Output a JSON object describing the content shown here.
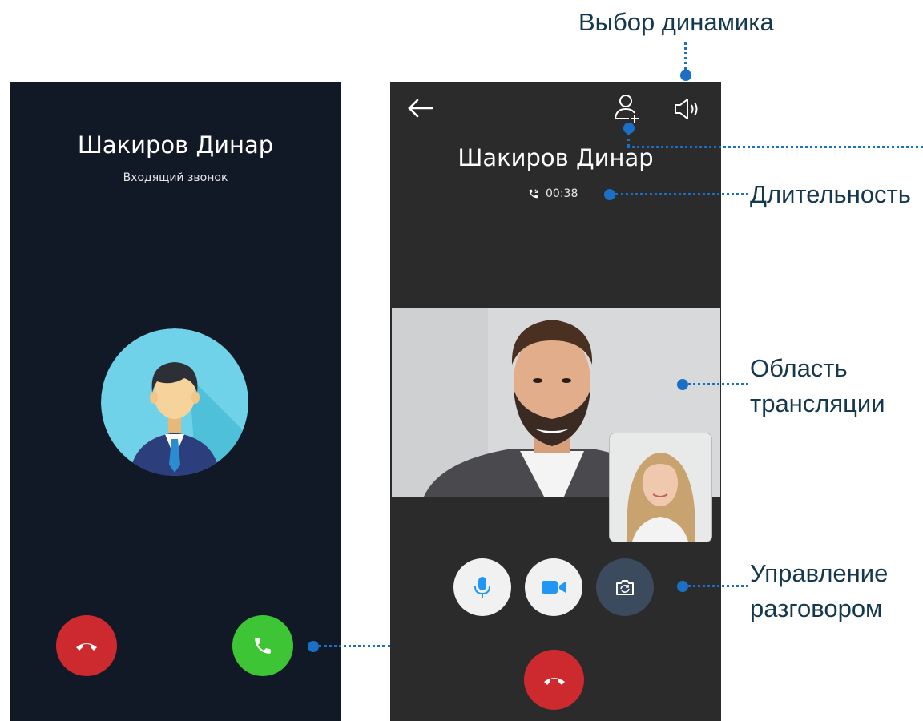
{
  "incoming_screen": {
    "contact_name": "Шакиров Динар",
    "call_status": "Входящий звонок",
    "decline_icon": "phone-hangup-icon",
    "accept_icon": "phone-icon"
  },
  "active_screen": {
    "contact_name": "Шакиров Динар",
    "duration": "00:38",
    "toolbar_icons": [
      "back-arrow-icon",
      "add-user-icon",
      "speaker-icon"
    ],
    "controls": [
      "microphone-icon",
      "video-camera-icon",
      "flip-camera-icon",
      "phone-hangup-icon"
    ]
  },
  "annotations": {
    "speaker_select": "Выбор динамика",
    "duration": "Длительность",
    "broadcast_area_line1": "Область",
    "broadcast_area_line2": "трансляции",
    "call_control_line1": "Управление",
    "call_control_line2": "разговором"
  },
  "colors": {
    "incoming_bg": "#111927",
    "active_bg": "#2b2b2b",
    "decline": "#cd2a2f",
    "accept": "#3ec536",
    "accent_blue": "#2196f3",
    "annotation_text": "#14384e",
    "annotation_marker": "#1b6fc4"
  }
}
